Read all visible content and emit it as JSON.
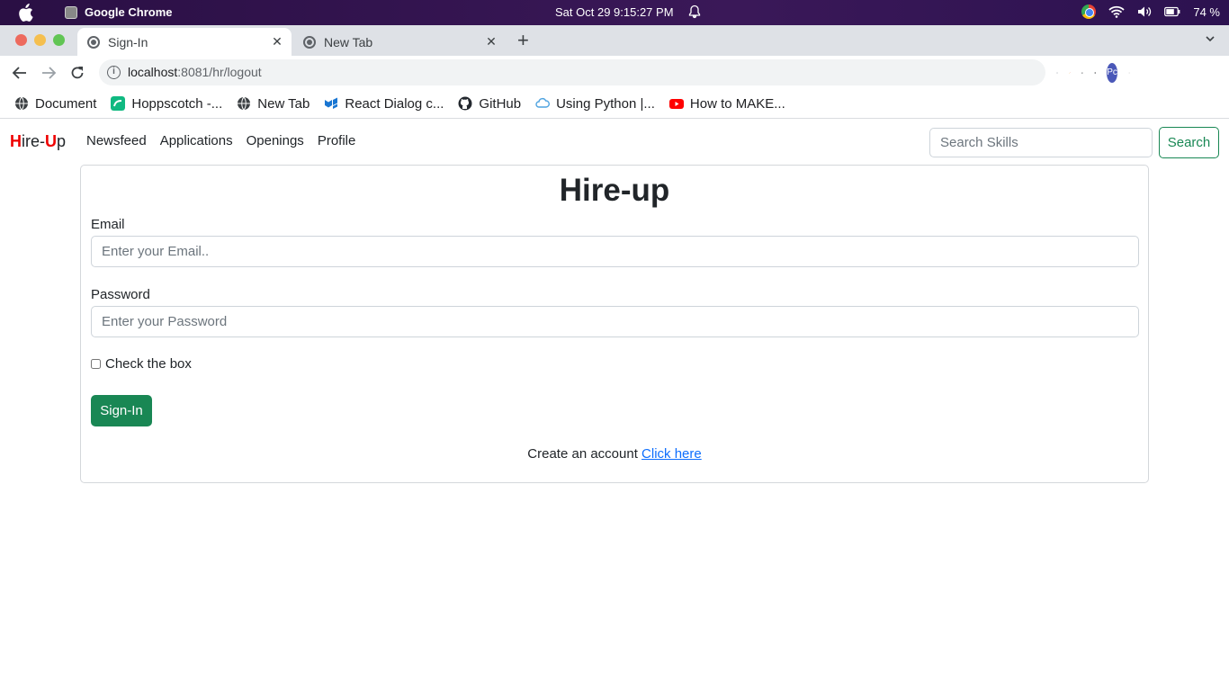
{
  "os": {
    "app_name": "Google Chrome",
    "clock": "Sat Oct 29   9:15:27 PM",
    "battery": "74 %"
  },
  "browser": {
    "tabs": [
      {
        "label": "Sign-In",
        "active": true
      },
      {
        "label": "New Tab",
        "active": false
      }
    ],
    "url_host": "localhost",
    "url_rest": ":8081/hr/logout",
    "profile_initials": "Pc",
    "bookmarks": [
      {
        "label": "Document",
        "icon": "globe-icon",
        "color": "#3c4043"
      },
      {
        "label": "Hoppscotch -...",
        "icon": "hoppscotch-icon",
        "color": "#10b981"
      },
      {
        "label": "New Tab",
        "icon": "globe-icon",
        "color": "#3c4043"
      },
      {
        "label": "React Dialog c...",
        "icon": "mui-icon",
        "color": "#1976d2"
      },
      {
        "label": "GitHub",
        "icon": "github-icon",
        "color": "#24292f"
      },
      {
        "label": "Using Python |...",
        "icon": "cloud-icon",
        "color": "#4fa3e0"
      },
      {
        "label": "How to MAKE...",
        "icon": "youtube-icon",
        "color": "#ff0000"
      }
    ]
  },
  "nav": {
    "brand_h": "H",
    "brand_mid": "ire-",
    "brand_u": "U",
    "brand_end": "p",
    "links": [
      "Newsfeed",
      "Applications",
      "Openings",
      "Profile"
    ],
    "search_placeholder": "Search Skills",
    "search_button": "Search"
  },
  "form": {
    "title": "Hire-up",
    "email_label": "Email",
    "email_placeholder": "Enter your Email..",
    "password_label": "Password",
    "password_placeholder": "Enter your Password",
    "checkbox_label": "Check the box",
    "submit_label": "Sign-In",
    "footer_text": "Create an account",
    "footer_link": "Click here"
  },
  "colors": {
    "success": "#198754",
    "brand_red": "#e00000",
    "link": "#0d6efd"
  }
}
